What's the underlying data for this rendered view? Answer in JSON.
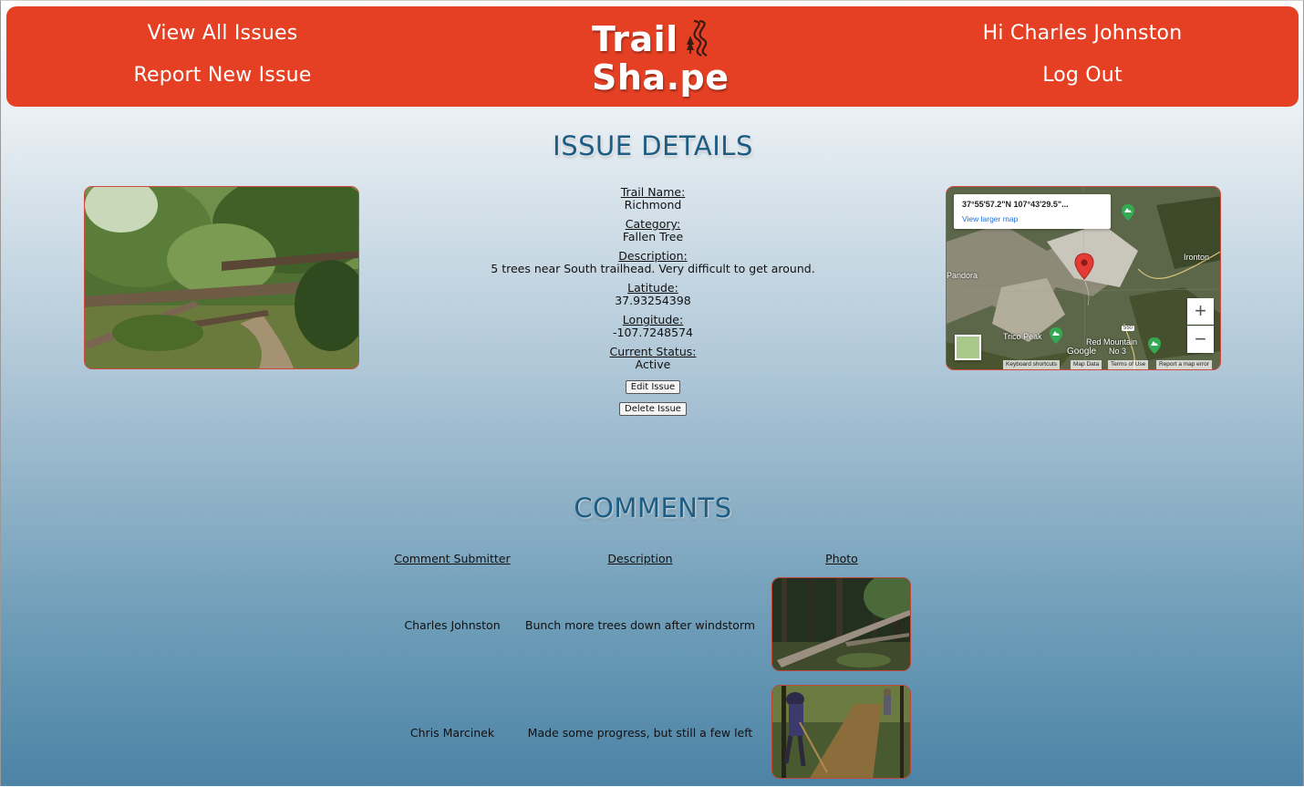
{
  "header": {
    "nav": {
      "view_all": "View All Issues",
      "report_new": "Report New Issue"
    },
    "logo": {
      "line1": "Trail",
      "line2": "Sha.pe"
    },
    "user": {
      "greeting": "Hi Charles Johnston",
      "logout": "Log Out"
    },
    "colors": {
      "header_bg": "#e54024",
      "title_color": "#1d5d84"
    }
  },
  "issue": {
    "title": "ISSUE DETAILS",
    "fields": [
      {
        "label": "Trail Name:",
        "value": "Richmond"
      },
      {
        "label": "Category:",
        "value": "Fallen Tree"
      },
      {
        "label": "Description:",
        "value": "5 trees near South trailhead. Very difficult to get around."
      },
      {
        "label": "Latitude:",
        "value": "37.93254398"
      },
      {
        "label": "Longitude:",
        "value": "-107.7248574"
      },
      {
        "label": "Current Status:",
        "value": "Active"
      }
    ],
    "edit_label": "Edit Issue",
    "delete_label": "Delete Issue",
    "photo_icon": "fallen-tree-photo"
  },
  "map": {
    "popup_coords": "37°55'57.2\"N 107°43'29.5\"...",
    "popup_link": "View larger map",
    "labels": {
      "pandora": "Pandora",
      "ironton": "Ironton",
      "trico": "Trico Peak",
      "red_mountain": "Red Mountain",
      "red_mountain_no": "No 3",
      "road": "550",
      "google": "Google"
    },
    "footer": {
      "shortcuts": "Keyboard shortcuts",
      "data": "Map Data",
      "terms": "Terms of Use",
      "report": "Report a map error"
    },
    "zoom_in": "+",
    "zoom_out": "−"
  },
  "comments": {
    "title": "COMMENTS",
    "headers": {
      "submitter": "Comment Submitter",
      "description": "Description",
      "photo": "Photo"
    },
    "rows": [
      {
        "submitter": "Charles Johnston",
        "description": "Bunch more trees down after windstorm"
      },
      {
        "submitter": "Chris Marcinek",
        "description": "Made some progress, but still a few left"
      }
    ]
  }
}
